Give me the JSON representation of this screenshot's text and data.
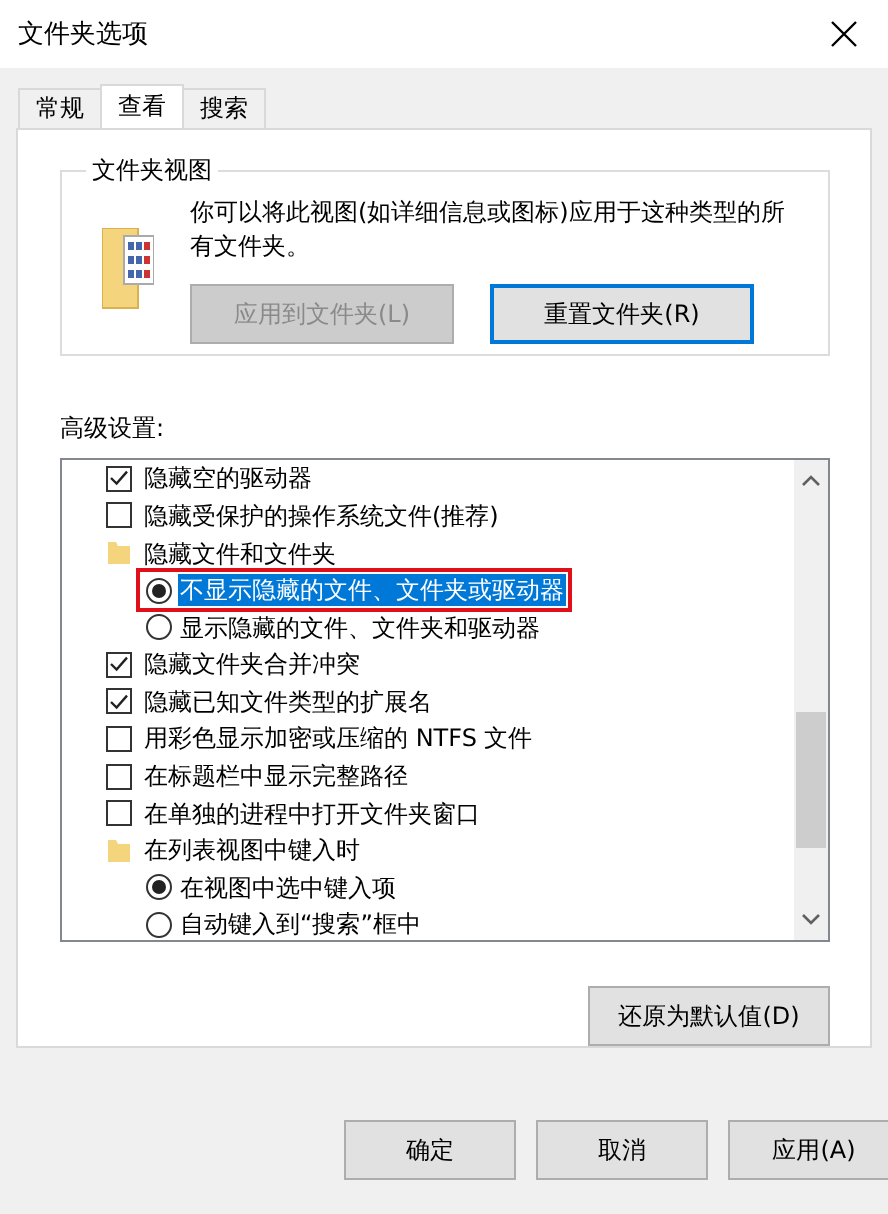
{
  "window": {
    "title": "文件夹选项"
  },
  "tabs": [
    {
      "label": "常规",
      "selected": false
    },
    {
      "label": "查看",
      "selected": true
    },
    {
      "label": "搜索",
      "selected": false
    }
  ],
  "folder_views": {
    "title": "文件夹视图",
    "description": "你可以将此视图(如详细信息或图标)应用于这种类型的所有文件夹。",
    "buttons": [
      {
        "label": "应用到文件夹(L)",
        "disabled": true,
        "focused": false
      },
      {
        "label": "重置文件夹(R)",
        "disabled": false,
        "focused": true
      }
    ]
  },
  "advanced": {
    "label": "高级设置:",
    "items": [
      {
        "kind": "checkbox",
        "label": "隐藏空的驱动器",
        "checked": true
      },
      {
        "kind": "checkbox",
        "label": "隐藏受保护的操作系统文件(推荐)",
        "checked": false
      },
      {
        "kind": "group",
        "label": "隐藏文件和文件夹",
        "children": [
          {
            "label": "不显示隐藏的文件、文件夹或驱动器",
            "selected": true,
            "highlighted": true,
            "outlined": true
          },
          {
            "label": "显示隐藏的文件、文件夹和驱动器",
            "selected": false,
            "highlighted": false,
            "outlined": false
          }
        ]
      },
      {
        "kind": "checkbox",
        "label": "隐藏文件夹合并冲突",
        "checked": true
      },
      {
        "kind": "checkbox",
        "label": "隐藏已知文件类型的扩展名",
        "checked": true
      },
      {
        "kind": "checkbox",
        "label": "用彩色显示加密或压缩的 NTFS 文件",
        "checked": false
      },
      {
        "kind": "checkbox",
        "label": "在标题栏中显示完整路径",
        "checked": false
      },
      {
        "kind": "checkbox",
        "label": "在单独的进程中打开文件夹窗口",
        "checked": false
      },
      {
        "kind": "group",
        "label": "在列表视图中键入时",
        "children": [
          {
            "label": "在视图中选中键入项",
            "selected": true,
            "highlighted": false,
            "outlined": false
          },
          {
            "label": "自动键入到“搜索”框中",
            "selected": false,
            "highlighted": false,
            "outlined": false
          }
        ]
      }
    ],
    "restore_button": "还原为默认值(D)"
  },
  "footer_buttons": [
    "确定",
    "取消",
    "应用(A)"
  ]
}
